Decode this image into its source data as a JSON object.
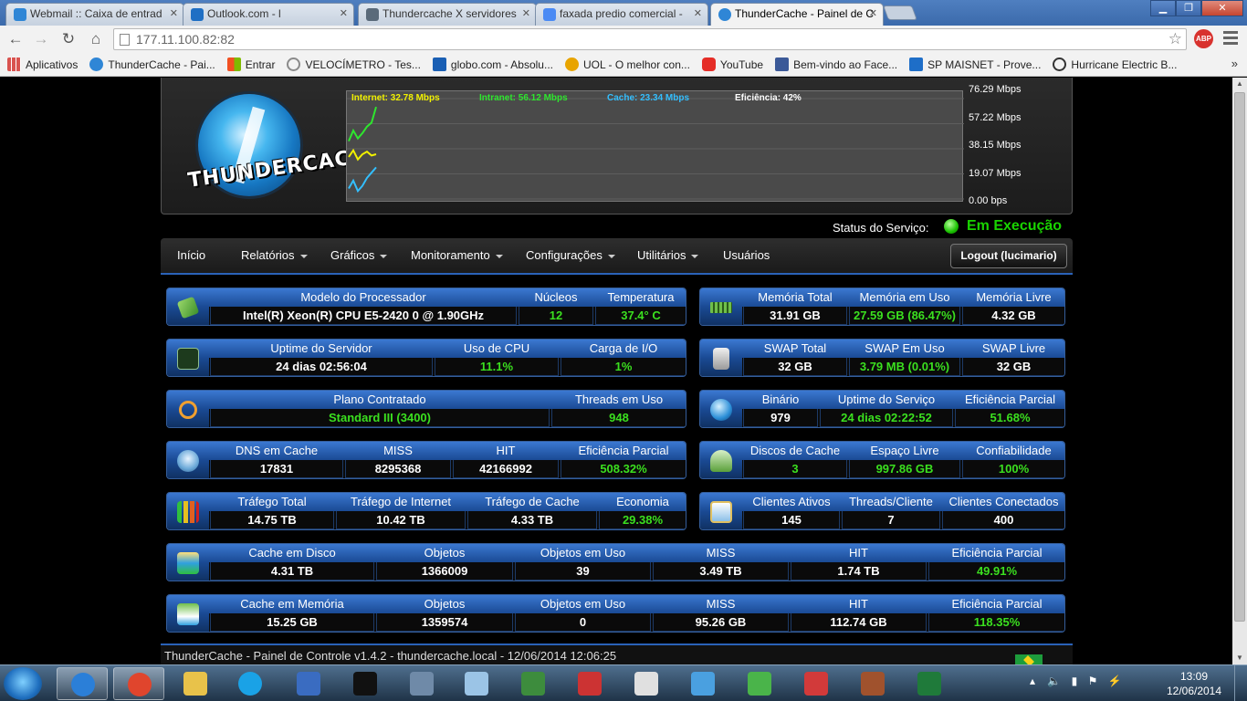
{
  "browser": {
    "tabs": [
      {
        "title": "Webmail :: Caixa de entrad",
        "color": "#2f86d6"
      },
      {
        "title": "Outlook.com - l",
        "color": "#1f6fc4"
      },
      {
        "title": "Thundercache X servidores",
        "color": "#5a6a7a"
      },
      {
        "title": "faxada predio comercial - ",
        "color": "#4a8af4"
      },
      {
        "title": "ThunderCache - Painel de C",
        "color": "#2f86d6"
      }
    ],
    "url": "177.11.100.82:82",
    "bookmarks": [
      {
        "label": "Aplicativos",
        "color": "#d9534f"
      },
      {
        "label": "ThunderCache - Pai...",
        "color": "#2f86d6"
      },
      {
        "label": "Entrar",
        "color": "#f25022"
      },
      {
        "label": "VELOCÍMETRO - Tes...",
        "color": "#8a8a8a"
      },
      {
        "label": "globo.com - Absolu...",
        "color": "#1a5fb4"
      },
      {
        "label": "UOL - O melhor con...",
        "color": "#e8a400"
      },
      {
        "label": "YouTube",
        "color": "#e52d27"
      },
      {
        "label": "Bem-vindo ao Face...",
        "color": "#3b5998"
      },
      {
        "label": "SP MAISNET - Prove...",
        "color": "#1e6ec8"
      },
      {
        "label": "Hurricane Electric B...",
        "color": "#333333"
      }
    ],
    "bookmarks_more": "»"
  },
  "header": {
    "logo_text": "THUNDERCACHE",
    "legend": {
      "internet": "Internet: 32.78 Mbps",
      "intranet": "Intranet: 56.12 Mbps",
      "cache": "Cache: 23.34 Mbps",
      "efficiency": "Eficiência: 42%"
    },
    "y_ticks": [
      "76.29 Mbps",
      "57.22 Mbps",
      "38.15 Mbps",
      "19.07 Mbps",
      "0.00 bps"
    ],
    "series_colors": {
      "internet": "#f1f100",
      "intranet": "#2ee62e",
      "cache": "#33bfff",
      "efficiency": "#ffffff"
    }
  },
  "chart_data": {
    "type": "line",
    "ylim": [
      0,
      76.29
    ],
    "y_tick_labels": [
      "76.29 Mbps",
      "57.22 Mbps",
      "38.15 Mbps",
      "19.07 Mbps",
      "0.00 bps"
    ],
    "series": [
      {
        "name": "Internet: 32.78 Mbps",
        "values": [
          32,
          37,
          30,
          34,
          36,
          33,
          34
        ]
      },
      {
        "name": "Intranet: 56.12 Mbps",
        "values": [
          44,
          52,
          46,
          50,
          55,
          58,
          70
        ]
      },
      {
        "name": "Cache: 23.34 Mbps",
        "values": [
          8,
          14,
          6,
          10,
          16,
          20,
          24
        ]
      }
    ]
  },
  "status": {
    "label": "Status do Serviço:",
    "value": "Em Execução"
  },
  "nav": {
    "items": [
      "Início",
      "Relatórios",
      "Gráficos",
      "Monitoramento",
      "Configurações",
      "Utilitários",
      "Usuários"
    ],
    "logout": "Logout (lucimario)"
  },
  "panels": {
    "cpu": {
      "h": [
        "Modelo do Processador",
        "Núcleos",
        "Temperatura"
      ],
      "v": [
        "Intel(R) Xeon(R) CPU E5-2420 0 @ 1.90GHz",
        "12",
        "37.4° C"
      ]
    },
    "mem": {
      "h": [
        "Memória Total",
        "Memória em Uso",
        "Memória Livre"
      ],
      "v": [
        "31.91 GB",
        "27.59 GB (86.47%)",
        "4.32 GB"
      ]
    },
    "uptime": {
      "h": [
        "Uptime do Servidor",
        "Uso de CPU",
        "Carga de I/O"
      ],
      "v": [
        "24 dias 02:56:04",
        "11.1%",
        "1%"
      ]
    },
    "swap": {
      "h": [
        "SWAP Total",
        "SWAP Em Uso",
        "SWAP Livre"
      ],
      "v": [
        "32 GB",
        "3.79 MB (0.01%)",
        "32 GB"
      ]
    },
    "plan": {
      "h": [
        "Plano Contratado",
        "Threads em Uso"
      ],
      "v": [
        "Standard III (3400)",
        "948"
      ]
    },
    "binary": {
      "h": [
        "Binário",
        "Uptime do Serviço",
        "Eficiência Parcial"
      ],
      "v": [
        "979",
        "24 dias 02:22:52",
        "51.68%"
      ]
    },
    "dns": {
      "h": [
        "DNS em Cache",
        "MISS",
        "HIT",
        "Eficiência Parcial"
      ],
      "v": [
        "17831",
        "8295368",
        "42166992",
        "508.32%"
      ]
    },
    "disks": {
      "h": [
        "Discos de Cache",
        "Espaço Livre",
        "Confiabilidade"
      ],
      "v": [
        "3",
        "997.86 GB",
        "100%"
      ]
    },
    "traffic": {
      "h": [
        "Tráfego Total",
        "Tráfego de Internet",
        "Tráfego de Cache",
        "Economia"
      ],
      "v": [
        "14.75 TB",
        "10.42 TB",
        "4.33 TB",
        "29.38%"
      ]
    },
    "clients": {
      "h": [
        "Clientes Ativos",
        "Threads/Cliente",
        "Clientes Conectados"
      ],
      "v": [
        "145",
        "7",
        "400"
      ]
    },
    "diskcache": {
      "h": [
        "Cache em Disco",
        "Objetos",
        "Objetos em Uso",
        "MISS",
        "HIT",
        "Eficiência Parcial"
      ],
      "v": [
        "4.31 TB",
        "1366009",
        "39",
        "3.49 TB",
        "1.74 TB",
        "49.91%"
      ]
    },
    "memcache": {
      "h": [
        "Cache em Memória",
        "Objetos",
        "Objetos em Uso",
        "MISS",
        "HIT",
        "Eficiência Parcial"
      ],
      "v": [
        "15.25 GB",
        "1359574",
        "0",
        "95.26 GB",
        "112.74 GB",
        "118.35%"
      ]
    }
  },
  "footer": {
    "text": "ThunderCache - Painel de Controle v1.4.2 - thundercache.local - 12/06/2014 12:06:25"
  },
  "taskbar": {
    "clock_time": "13:09",
    "clock_date": "12/06/2014",
    "apps": [
      {
        "name": "internet-explorer",
        "color": "#2b7fd8"
      },
      {
        "name": "chrome",
        "color": "#e0452d"
      },
      {
        "name": "explorer",
        "color": "#e8c24a"
      },
      {
        "name": "skype",
        "color": "#1aa2e6"
      },
      {
        "name": "thunderbird",
        "color": "#3a6cc1"
      },
      {
        "name": "cmd",
        "color": "#111111"
      },
      {
        "name": "security",
        "color": "#6f8aa8"
      },
      {
        "name": "notepad",
        "color": "#9bc4e6"
      },
      {
        "name": "network",
        "color": "#3d8c3d"
      },
      {
        "name": "tool",
        "color": "#cc3333"
      },
      {
        "name": "java",
        "color": "#e0e0e0"
      },
      {
        "name": "remote",
        "color": "#4aa0e0"
      },
      {
        "name": "search",
        "color": "#4ab44a"
      },
      {
        "name": "photo",
        "color": "#d23a3a"
      },
      {
        "name": "network-tool",
        "color": "#a0522d"
      },
      {
        "name": "excel",
        "color": "#1f7a3a"
      }
    ]
  }
}
